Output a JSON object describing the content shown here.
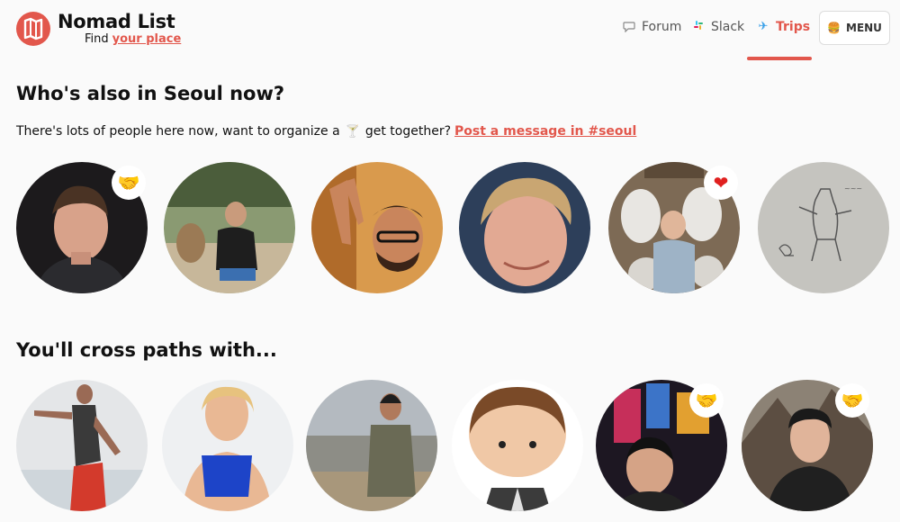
{
  "brand": {
    "title": "Nomad List",
    "subtitle_prefix": "Find",
    "subtitle_link": "your place"
  },
  "nav": {
    "forum": "Forum",
    "slack": "Slack",
    "trips": "Trips",
    "menu": "MENU"
  },
  "section_seoul": {
    "heading": "Who's also in Seoul now?",
    "intro_before": "There's lots of people here now, want to organize a",
    "intro_after": "get together?",
    "intro_link": "Post a message in #seoul"
  },
  "section_cross": {
    "heading": "You'll cross paths with..."
  },
  "icons": {
    "forum": "speech-bubble-icon",
    "slack": "slack-icon",
    "trips": "airplane-icon",
    "menu": "burger-icon",
    "cocktail": "cocktail-icon",
    "handshake": "handshake-icon",
    "heart": "heart-icon"
  },
  "colors": {
    "accent": "#e2574c"
  }
}
